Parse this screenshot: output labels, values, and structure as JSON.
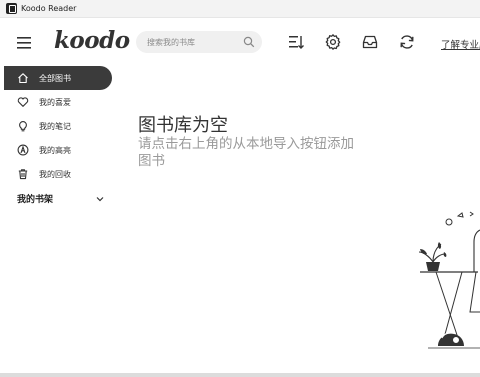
{
  "titlebar": {
    "title": "Koodo Reader"
  },
  "header": {
    "logo": "koodo",
    "search_placeholder": "搜索我的书库",
    "link": "了解专业版"
  },
  "sidebar": {
    "items": [
      {
        "label": "全部图书",
        "icon": "home-icon",
        "active": true
      },
      {
        "label": "我的喜爱",
        "icon": "heart-icon",
        "active": false
      },
      {
        "label": "我的笔记",
        "icon": "lightbulb-icon",
        "active": false
      },
      {
        "label": "我的高亮",
        "icon": "highlight-icon",
        "active": false
      },
      {
        "label": "我的回收",
        "icon": "trash-icon",
        "active": false
      }
    ],
    "shelf_label": "我的书架"
  },
  "main": {
    "empty_title": "图书库为空",
    "empty_description": "请点击右上角的从本地导入按钮添加图书"
  },
  "colors": {
    "accent": "#3b3b3b",
    "muted_text": "#9a9a9a",
    "search_bg": "#f0f0f0"
  }
}
